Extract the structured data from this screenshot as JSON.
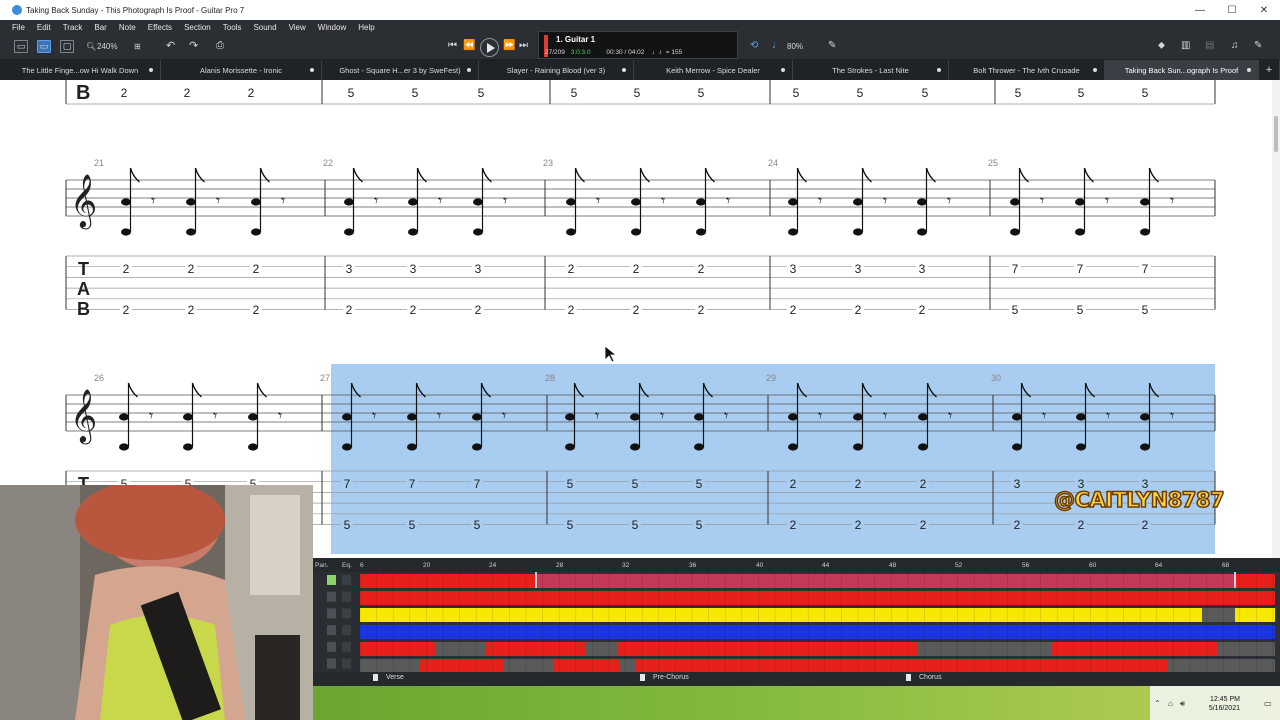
{
  "window": {
    "title": "Taking Back Sunday - This Photograph Is Proof - Guitar Pro 7",
    "minimize": "—",
    "maximize": "☐",
    "close": "✕"
  },
  "menu": [
    "File",
    "Edit",
    "Track",
    "Bar",
    "Note",
    "Effects",
    "Section",
    "Tools",
    "Sound",
    "View",
    "Window",
    "Help"
  ],
  "toolbar": {
    "zoom": "240%",
    "track_name": "1. Guitar 1",
    "bar_position": "27/209",
    "beat": "3:0:3.0",
    "time": "00:30 / 04:02",
    "tempo": "= 155",
    "volume": "80%"
  },
  "tabs": [
    {
      "label": "The Little Finge...ow Hi Walk Down",
      "active": false
    },
    {
      "label": "Alanis Morissette - Ironic",
      "active": false
    },
    {
      "label": "Ghost - Square H...er 3 by SweFest)",
      "active": false
    },
    {
      "label": "Slayer - Raining Blood (ver 3)",
      "active": false
    },
    {
      "label": "Keith Merrow - Spice Dealer",
      "active": false
    },
    {
      "label": "The Strokes - Last Nite",
      "active": false
    },
    {
      "label": "Bolt Thrower - The Ivth Crusade",
      "active": false
    },
    {
      "label": "Taking Back Sun...ograph Is Proof",
      "active": true
    }
  ],
  "score": {
    "top_system": {
      "b_string": [
        "2",
        "2",
        "2",
        "5",
        "5",
        "5",
        "5",
        "5",
        "5",
        "5",
        "5",
        "5",
        "5",
        "5",
        "5"
      ]
    },
    "system1": {
      "bar_numbers": [
        "21",
        "22",
        "23",
        "24",
        "25"
      ],
      "t_string": [
        "2",
        "2",
        "2",
        "3",
        "3",
        "3",
        "2",
        "2",
        "2",
        "3",
        "3",
        "3",
        "7",
        "7",
        "7"
      ],
      "b_string": [
        "2",
        "2",
        "2",
        "2",
        "2",
        "2",
        "2",
        "2",
        "2",
        "2",
        "2",
        "2",
        "5",
        "5",
        "5"
      ]
    },
    "system2": {
      "bar_numbers": [
        "26",
        "27",
        "28",
        "29",
        "30"
      ],
      "t_string": [
        "5",
        "5",
        "5",
        "7",
        "7",
        "7",
        "5",
        "5",
        "5",
        "2",
        "2",
        "2",
        "3",
        "3",
        "3"
      ],
      "b_string": [
        "5",
        "5",
        "5",
        "5",
        "5",
        "5",
        "5",
        "5",
        "5",
        "2",
        "2",
        "2",
        "2",
        "2",
        "2"
      ]
    }
  },
  "mixer": {
    "pan_label": "Pan.",
    "eq_label": "Eq.",
    "ruler": [
      "6",
      "20",
      "24",
      "28",
      "32",
      "36",
      "40",
      "44",
      "48",
      "52",
      "56",
      "60",
      "64",
      "68"
    ],
    "colors": {
      "red": "#e8201c",
      "yellow": "#f6e800",
      "blue": "#1a34e0",
      "gray": "#5a5a5a",
      "pink": "#c23a55"
    }
  },
  "sections": [
    {
      "label": "Verse"
    },
    {
      "label": "Pre-Chorus"
    },
    {
      "label": "Chorus"
    }
  ],
  "watermark": "@CAITLYN8787",
  "taskbar": {
    "time": "12:45 PM",
    "date": "5/16/2021"
  }
}
